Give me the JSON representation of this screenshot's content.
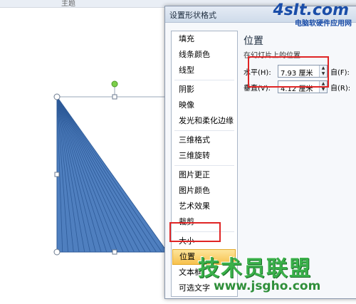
{
  "ribbon": {
    "group_label": "主题"
  },
  "dialog": {
    "title": "设置形状格式",
    "nav_items": [
      "填充",
      "线条颜色",
      "线型",
      "阴影",
      "映像",
      "发光和柔化边缘",
      "三维格式",
      "三维旋转",
      "图片更正",
      "图片颜色",
      "艺术效果",
      "裁剪",
      "大小",
      "位置",
      "文本框",
      "可选文字"
    ],
    "active_item": "位置",
    "panel": {
      "heading": "位置",
      "subheading": "在幻灯片上的位置",
      "horizontal": {
        "label": "水平(H):",
        "value": "7.93 厘米",
        "from_label": "自(F):"
      },
      "vertical": {
        "label": "垂直(V):",
        "value": "4.12 厘米",
        "from_label": "自(R):"
      }
    }
  },
  "shape": {
    "fill_color": "#4f7fbf",
    "line_color": "#2e5b99"
  },
  "logos": {
    "top_right": "4sIt.com",
    "top_right_site": "电脑软硬件应用网",
    "watermark_text": "技术员联盟",
    "watermark_url": "www.jsgho.com"
  },
  "colors": {
    "highlight": "#e02525",
    "active_nav": "#f7c14d"
  }
}
